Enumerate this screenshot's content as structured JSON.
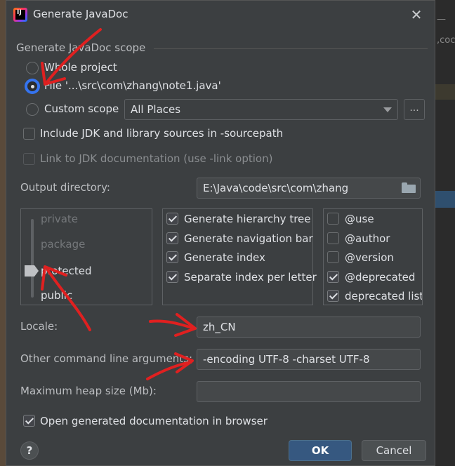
{
  "window": {
    "title": "Generate JavaDoc",
    "close_glyph": "✕",
    "app_icon": "intellij-logo"
  },
  "background": {
    "right_text_1": ",coc",
    "right_text_2": "—"
  },
  "scope": {
    "section_label": "Generate JavaDoc scope",
    "options": [
      {
        "label": "Whole project",
        "selected": false
      },
      {
        "label": "File '...\\src\\com\\zhang\\note1.java'",
        "selected": true
      },
      {
        "label": "Custom scope",
        "selected": false
      }
    ],
    "custom_scope_value": "All Places",
    "ellipsis_label": "..."
  },
  "options": {
    "include_jdk": {
      "label": "Include JDK and library sources in -sourcepath",
      "checked": false
    },
    "link_jdk": {
      "label": "Link to JDK documentation (use -link option)",
      "checked": false,
      "disabled": true
    }
  },
  "output": {
    "label": "Output directory:",
    "value": "E:\\Java\\code\\src\\com\\zhang"
  },
  "visibility": {
    "levels": [
      "private",
      "package",
      "protected",
      "public"
    ],
    "selected": "protected"
  },
  "generate": [
    {
      "label": "Generate hierarchy tree",
      "checked": true
    },
    {
      "label": "Generate navigation bar",
      "checked": true
    },
    {
      "label": "Generate index",
      "checked": true
    },
    {
      "label": "Separate index per letter",
      "checked": true
    }
  ],
  "tags": [
    {
      "label": "@use",
      "checked": false
    },
    {
      "label": "@author",
      "checked": false
    },
    {
      "label": "@version",
      "checked": false
    },
    {
      "label": "@deprecated",
      "checked": true
    },
    {
      "label": "deprecated list",
      "checked": true
    }
  ],
  "locale": {
    "label": "Locale:",
    "value": "zh_CN"
  },
  "other_args": {
    "label": "Other command line arguments:",
    "value": "-encoding UTF-8 -charset UTF-8"
  },
  "heap": {
    "label": "Maximum heap size (Mb):",
    "value": ""
  },
  "open_browser": {
    "label": "Open generated documentation in browser",
    "checked": true
  },
  "buttons": {
    "help": "?",
    "ok": "OK",
    "cancel": "Cancel"
  },
  "colors": {
    "accent": "#3574f0",
    "annotation": "#e02020",
    "dialog_bg": "#3c3f41"
  }
}
